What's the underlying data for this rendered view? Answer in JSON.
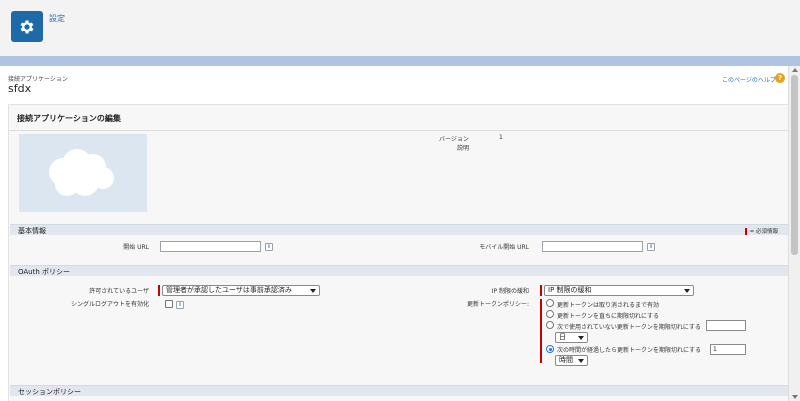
{
  "header": {
    "title": "設定",
    "logo_icon": "gear-icon",
    "logo_color": "#1c6aa8"
  },
  "page": {
    "breadcrumb": "接続アプリケーション",
    "app_name": "sfdx",
    "help_link": "このページのヘルプ",
    "help_icon": "?"
  },
  "panel": {
    "title": "接続アプリケーションの編集",
    "version_label": "バージョン",
    "version_value": "1",
    "description_label": "説明"
  },
  "basic_info": {
    "section_title": "基本情報",
    "required_legend": "= 必須情報",
    "start_url_label": "開始 URL",
    "start_url_value": "",
    "mobile_start_url_label": "モバイル開始 URL",
    "mobile_start_url_value": "",
    "info_icon": "i"
  },
  "oauth_policy": {
    "section_title": "OAuth ポリシー",
    "permitted_users_label": "許可されているユーザ",
    "permitted_users_value": "管理者が承認したユーザは事前承認済み",
    "ip_relax_label": "IP 制限の緩和",
    "ip_relax_value": "IP 制限の緩和",
    "single_logout_label": "シングルログアウトを有効化",
    "single_logout_checked": false,
    "refresh_token_label": "更新トークンポリシー:",
    "refresh_options": [
      {
        "label": "更新トークンは取り消されるまで有効",
        "selected": false
      },
      {
        "label": "更新トークンを直ちに期限切れにする",
        "selected": false
      },
      {
        "label": "次で使用されていない更新トークンを期限切れにする",
        "selected": false
      },
      {
        "label": "次の時間が経過したら更新トークンを期限切れにする",
        "selected": true
      }
    ],
    "unused_amount_value": "",
    "unused_unit_value": "日",
    "elapsed_amount_value": "1",
    "elapsed_unit_value": "時間"
  },
  "session_policy": {
    "section_title": "セッションポリシー"
  },
  "colors": {
    "accent": "#2a6eb0",
    "required": "#cc0000",
    "band": "#b0c4df",
    "section_bg": "#e2e6ee"
  }
}
